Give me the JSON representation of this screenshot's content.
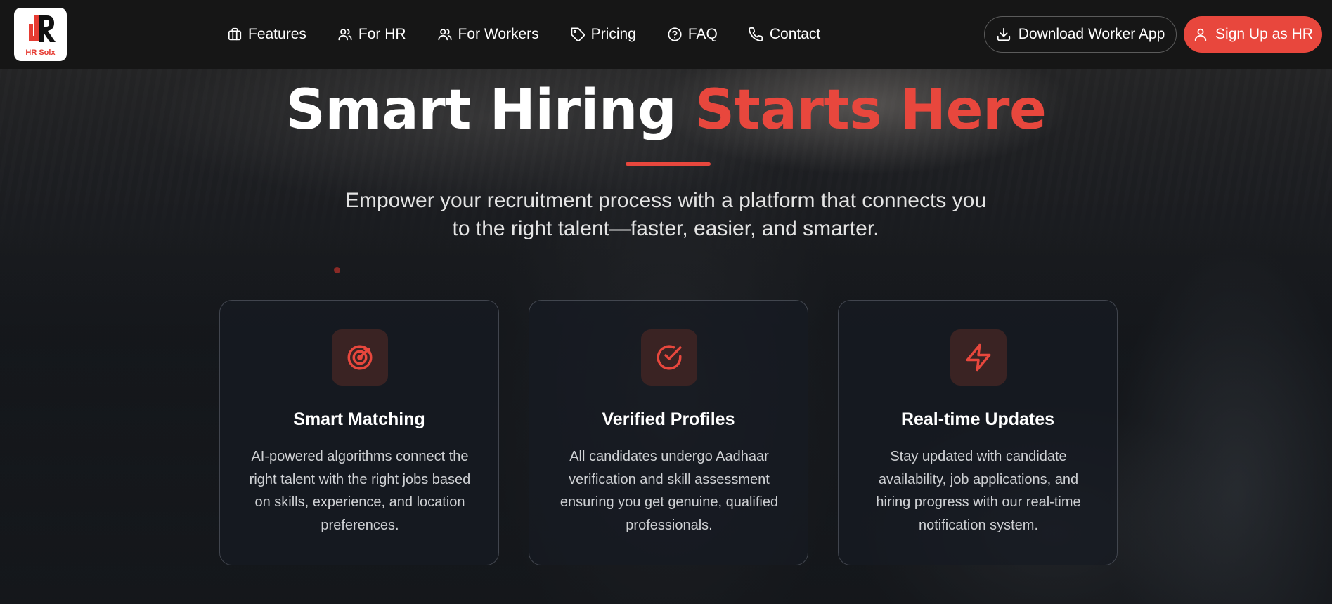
{
  "brand": {
    "logo_text": "HR Solx",
    "accent": "#e8473d"
  },
  "nav": {
    "items": [
      {
        "label": "Features",
        "icon": "briefcase-icon"
      },
      {
        "label": "For HR",
        "icon": "users-icon"
      },
      {
        "label": "For Workers",
        "icon": "users-icon"
      },
      {
        "label": "Pricing",
        "icon": "tag-icon"
      },
      {
        "label": "FAQ",
        "icon": "help-circle-icon"
      },
      {
        "label": "Contact",
        "icon": "phone-icon"
      }
    ],
    "download_label": "Download Worker App",
    "signup_label": "Sign Up as HR"
  },
  "hero": {
    "title_main": "Smart Hiring",
    "title_accent": "Starts Here",
    "subtitle_line1": "Empower your recruitment process with a platform that connects you",
    "subtitle_line2": "to the right talent—faster, easier, and smarter."
  },
  "features": [
    {
      "icon": "target-icon",
      "title": "Smart Matching",
      "description": "AI-powered algorithms connect the right talent with the right jobs based on skills, experience, and location preferences."
    },
    {
      "icon": "check-circle-icon",
      "title": "Verified Profiles",
      "description": "All candidates undergo Aadhaar verification and skill assessment ensuring you get genuine, qualified professionals."
    },
    {
      "icon": "zap-icon",
      "title": "Real-time Updates",
      "description": "Stay updated with candidate availability, job applications, and hiring progress with our real-time notification system."
    }
  ]
}
